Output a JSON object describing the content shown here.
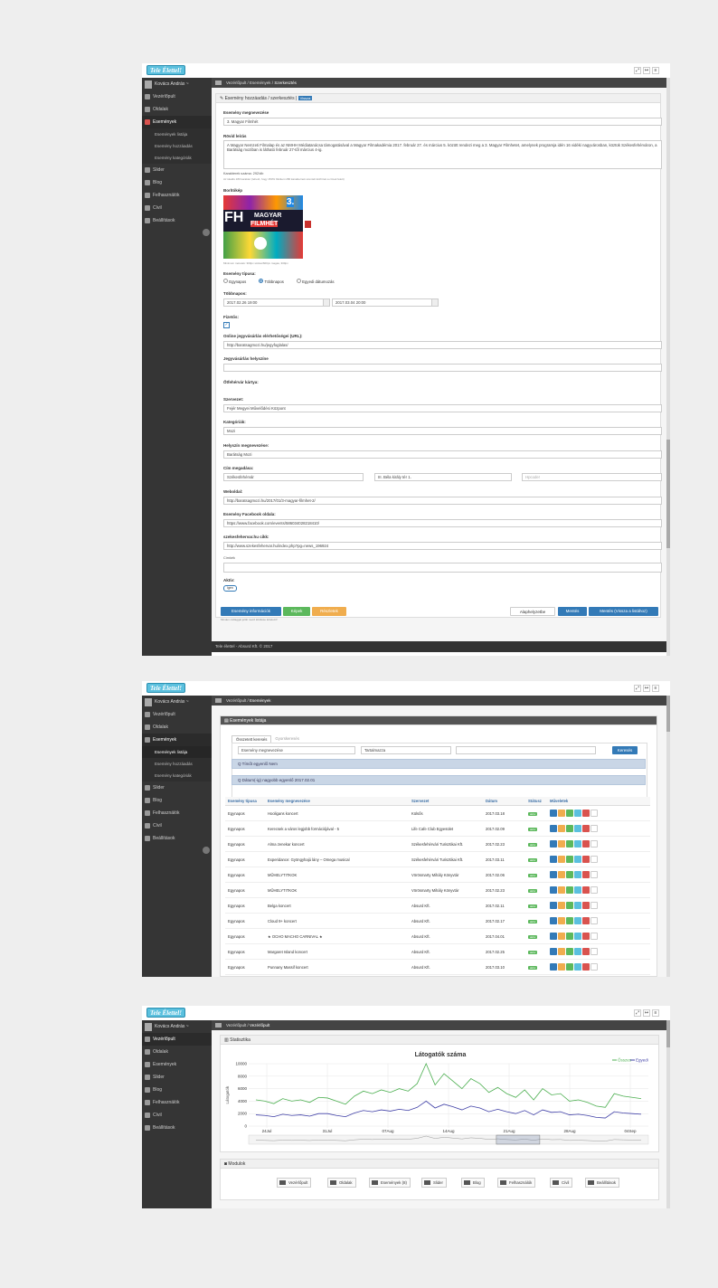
{
  "logo": "Tele Élettel!",
  "user": "Kovács András ~",
  "footer": "Tele élettel - Absurd Kft. © 2017",
  "sidebar": {
    "dashboard": "Vezérlőpult",
    "pages": "Oldalak",
    "events": "Események",
    "events_list": "Események listája",
    "events_add": "Esemény hozzáadás",
    "events_cats": "Esemény kategóriák",
    "slider": "Slider",
    "blog": "Blog",
    "users": "Felhasználók",
    "tags": "Cívil",
    "settings": "Beállítások"
  },
  "s1": {
    "crumb_a": "Vezérlőpult",
    "crumb_b": "Események",
    "crumb_c": "Szerkesztés",
    "panel_title": "Esemény hozzáadás / szerkesztés |",
    "back": "Vissza",
    "name_label": "Esemény megnevezése",
    "name_val": "3. Magyar Filmhét",
    "desc_label": "Rövid leírás",
    "desc_val": "A Magyar Nemzeti Filmalap és az NMHH Médiatanácsa támogatásával a Magyar Filmakadémia 2017. február 27. és március 5. között rendezi meg a 3. Magyar Filmhetet, amelynek programja idén 16 vidéki nagyvárosban, köztük Székesfehérváron, a Barátság moziban is látható február 27-től március 4-ig.",
    "chars": "Karakterek száma: 292/db",
    "chars_hint": "Az ideális 180 karakter (lehető, hogy 150% fölötteni 280 karakternek szentelt közhírek a címek felett)",
    "cover_label": "Borítókép",
    "cover_hint": "Minimum méretek: 300px széles/600px magas, 300px",
    "cover_big": "FH",
    "cover_word": "MAGYAR",
    "cover_word2": "FILMHÉT",
    "cover_num": "3.",
    "type_label": "Esemény típusa:",
    "type_opts": [
      "Egynapos",
      "Többnapos",
      "Egyedi dátumozás"
    ],
    "multi_label": "Többnapos:",
    "date_from": "2017.02.26 19:00",
    "date_to": "2017.03.04 20:00",
    "paid_label": "Fizetős:",
    "ticket_label": "Online jegyvásárlás elérhetőségei (URL):",
    "ticket_val": "http://baratsagmozi.hu/jegyfoglalas/",
    "ticketplace_label": "Jegyvásárlás helyszíne",
    "card_label": "Őtfehérvár kártya:",
    "org_label": "Szervezet:",
    "org_val": "Fejér Megyei Művelődési Központ",
    "cat_label": "Kategóriák:",
    "cat_val": "Mozi",
    "venue_label": "Helyszín megnevezése:",
    "venue_val": "Barátság Mozi",
    "addr_label": "Cím megadása:",
    "city": "Székesfehérvár",
    "street": "III. Béla király tér 1.",
    "extra_ph": "Hpcode!",
    "web_label": "Weboldal:",
    "web_val": "http://baratsagmozi.hu/2017/01/3-magyar-filmhet-2/",
    "fb_label": "Esemény Facebook oldala:",
    "fb_val": "https://www.facebook.com/events/586034028218410/",
    "szfv_label": "szekesfehervar.hu cikk:",
    "szfv_val": "http://www.szekesfehervar.hu/index.php?pg=news_196924",
    "tags_label": "Címkék",
    "active_label": "Aktív:",
    "active_val": "Igen",
    "btn_info": "Esemény információk",
    "btn_images": "Képek",
    "btn_details": "Részletek",
    "btn_reset": "Alaphelyzetbe",
    "btn_save": "Mentés",
    "btn_saveback": "Mentés (Vissza a listához)",
    "required_hint": "Minden csillaggal jelölt mező kitöltése kötelező!"
  },
  "s2": {
    "crumb_a": "Vezérlőpult",
    "crumb_b": "Események",
    "panel_title": "Események listája",
    "tab1": "Összetett keresés",
    "tab2": "Gyorskeresés",
    "sel1": "Esemény megnevezése",
    "sel2": "Tartalmazza",
    "search_btn": "Keresés",
    "filter1": "Q Tímőt egyenlő Nem",
    "filter2": "Q Dátum(-ig) nagyobb egyenlő 2017.02.01",
    "headers": [
      "Esemény típusa",
      "Esemény megnevezése",
      "Szervezet",
      "Dátum",
      "Státusz",
      "Műveletek"
    ],
    "status": "aktív",
    "rows": [
      [
        "Egynapos",
        "Hooligans koncert",
        "Külsős",
        "2017.03.18"
      ],
      [
        "Egynapos",
        "Kerecsek a város legjobb formációjával - 5",
        "Life Cafe Club Egyesület",
        "2017.02.09"
      ],
      [
        "Egynapos",
        "Alma zenekar koncert",
        "Székesfehérvári Turisztikai Kft.",
        "2017.02.23"
      ],
      [
        "Egynapos",
        "Experidance: Gyöngyhajú lány – Omega musical",
        "Székesfehérvári Turisztikai Kft.",
        "2017.03.11"
      ],
      [
        "Egynapos",
        "MŰHELYTITKOK",
        "Vörösmarty Mihály Könyvtár",
        "2017.02.06"
      ],
      [
        "Egynapos",
        "MŰHELYTITKOK",
        "Vörösmarty Mihály Könyvtár",
        "2017.02.23"
      ],
      [
        "Egynapos",
        "Belga koncert",
        "Absurd Kft.",
        "2017.02.11"
      ],
      [
        "Egynapos",
        "Cloud 9+ koncert",
        "Absurd Kft.",
        "2017.02.17"
      ],
      [
        "Egynapos",
        "★ OCHO MACHO CARNIVAL ★",
        "Absurd Kft.",
        "2017.04.01"
      ],
      [
        "Egynapos",
        "Margaret Island koncert",
        "Absurd Kft.",
        "2017.02.25"
      ],
      [
        "Egynapos",
        "Punnany Massif koncert",
        "Absurd Kft.",
        "2017.03.10"
      ]
    ]
  },
  "s3": {
    "crumb_a": "Vezérlőpult",
    "crumb_b": "Vezérlőpult",
    "stats_title": "Statisztika",
    "modules_title": "Modulok",
    "modules": [
      "Vezérlőpult",
      "Oldalak",
      "Események (8)",
      "Slider",
      "Blog",
      "Felhasználók",
      "Cívil",
      "Beállítások"
    ]
  },
  "chart_data": {
    "type": "line",
    "title": "Látogatók száma",
    "ylabel": "Látogatók",
    "ylim": [
      0,
      10000
    ],
    "yticks": [
      0,
      2000,
      4000,
      6000,
      8000,
      10000
    ],
    "xticks": [
      "24Jul",
      "31Jul",
      "07Aug",
      "14Aug",
      "21Aug",
      "28Aug",
      "04Sep"
    ],
    "series": [
      {
        "name": "Összes",
        "color": "#4caf50",
        "values": [
          4200,
          4000,
          3600,
          4400,
          4000,
          4200,
          3800,
          4600,
          4500,
          4000,
          3500,
          4800,
          5600,
          5200,
          5800,
          5400,
          6000,
          5600,
          6800,
          10000,
          6600,
          8400,
          7200,
          6000,
          7600,
          6800,
          5400,
          6200,
          5200,
          4600,
          5800,
          4200,
          6000,
          5000,
          5200,
          4000,
          4200,
          3800,
          3200,
          3000,
          5200,
          4800,
          4600,
          4400
        ]
      },
      {
        "name": "Egyedi",
        "color": "#3f3fa6",
        "values": [
          1800,
          1700,
          1500,
          1900,
          1700,
          1800,
          1600,
          2000,
          2000,
          1700,
          1500,
          2100,
          2500,
          2300,
          2600,
          2400,
          2700,
          2500,
          3000,
          4000,
          2900,
          3500,
          3100,
          2600,
          3200,
          2900,
          2300,
          2700,
          2300,
          2000,
          2500,
          1800,
          2600,
          2200,
          2300,
          1800,
          1900,
          1700,
          1400,
          1300,
          2300,
          2100,
          2000,
          1900
        ]
      }
    ]
  }
}
